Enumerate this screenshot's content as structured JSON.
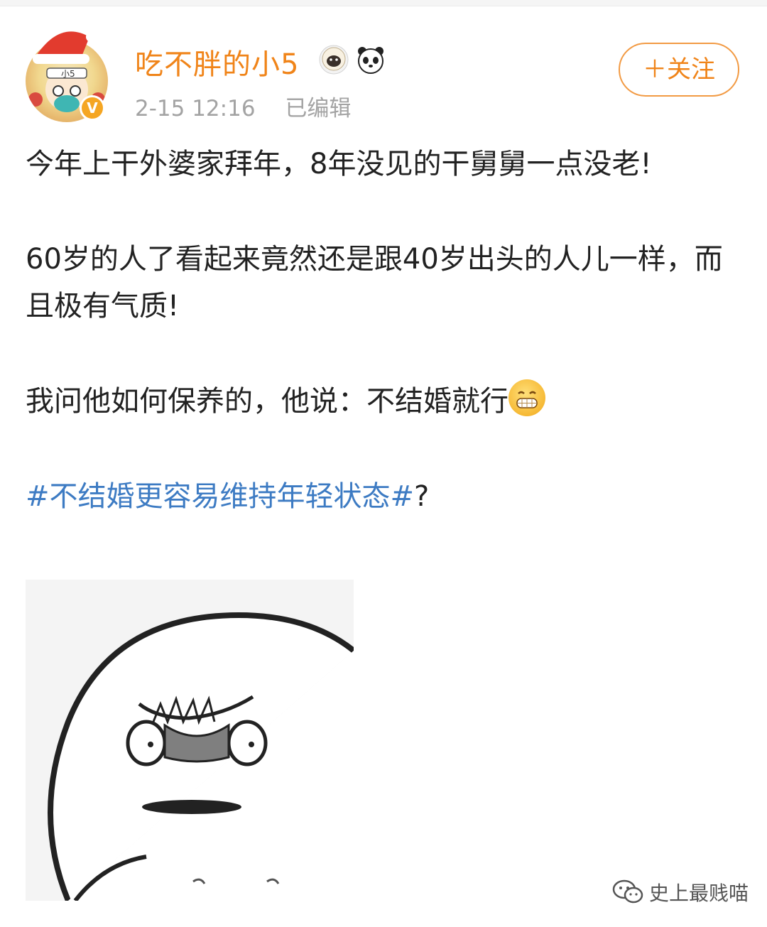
{
  "user": {
    "name": "吃不胖的小5",
    "timestamp": "2-15 12:16",
    "edited_label": "已编辑",
    "verified_badge": "V"
  },
  "follow_button": {
    "label": "＋关注"
  },
  "post": {
    "paragraph1": "今年上干外婆家拜年，8年没见的干舅舅一点没老!",
    "paragraph2": "60岁的人了看起来竟然还是跟40岁出头的人儿一样，而且极有气质!",
    "paragraph3": "我问他如何保养的，他说：不结婚就行",
    "hashtag": "#不结婚更容易维持年轻状态#",
    "hashtag_suffix": "?"
  },
  "watermark": {
    "text": "史上最贱喵"
  },
  "colors": {
    "username": "#f08419",
    "hashtag": "#3d7bc3",
    "meta": "#a3a3a3"
  },
  "icons": [
    "sheep-badge-icon",
    "panda-badge-icon",
    "grin-emoji-icon",
    "wechat-icon"
  ]
}
